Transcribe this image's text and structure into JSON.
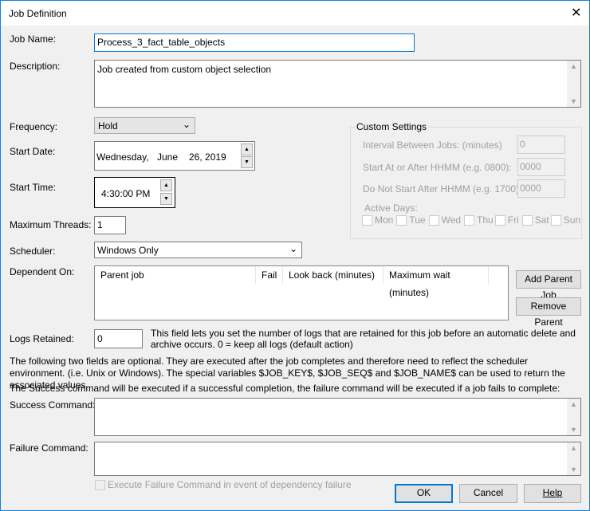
{
  "window": {
    "title": "Job Definition",
    "close": "✕"
  },
  "job_name": {
    "label": "Job Name:",
    "value": "Process_3_fact_table_objects"
  },
  "description": {
    "label": "Description:",
    "value": "Job created from custom object selection"
  },
  "frequency": {
    "label": "Frequency:",
    "value": "Hold"
  },
  "start_date": {
    "label": "Start Date:",
    "weekday": "Wednesday,",
    "month": "June",
    "day_year": "26, 2019"
  },
  "start_time": {
    "label": "Start Time:",
    "value": "4:30:00 PM"
  },
  "max_threads": {
    "label": "Maximum Threads:",
    "value": "1"
  },
  "scheduler": {
    "label": "Scheduler:",
    "value": "Windows Only"
  },
  "custom": {
    "title": "Custom Settings",
    "interval_label": "Interval Between Jobs: (minutes)",
    "interval": "0",
    "start_after_label": "Start At or After HHMM (e.g. 0800):",
    "start_after": "0000",
    "not_after_label": "Do Not Start After HHMM (e.g. 1700):",
    "not_after": "0000",
    "active_days_label": "Active Days:",
    "days": [
      "Mon",
      "Tue",
      "Wed",
      "Thu",
      "Fri",
      "Sat",
      "Sun"
    ]
  },
  "dependent": {
    "label": "Dependent On:",
    "columns": [
      "Parent job",
      "Fail",
      "Look back (minutes)",
      "Maximum wait (minutes)"
    ],
    "add": "Add Parent Job",
    "remove": "Remove Parent"
  },
  "logs": {
    "label": "Logs Retained:",
    "value": "0",
    "help": "This field lets you set the number of logs that are retained for this job before an automatic delete and archive occurs. 0 = keep all logs (default action)"
  },
  "info1": "The following two fields are optional. They are executed after the job completes and therefore need to reflect the scheduler environment. (i.e. Unix or Windows). The special variables $JOB_KEY$, $JOB_SEQ$ and $JOB_NAME$ can be used to return the associated values.",
  "info2": "The Success command will be executed if a successful completion, the failure command will be executed if a job fails to complete:",
  "success": {
    "label": "Success Command:",
    "value": ""
  },
  "failure": {
    "label": "Failure Command:",
    "value": ""
  },
  "exec_fail": {
    "label": "Execute Failure Command in event of dependency failure"
  },
  "buttons": {
    "ok": "OK",
    "cancel": "Cancel",
    "help": "Help"
  }
}
